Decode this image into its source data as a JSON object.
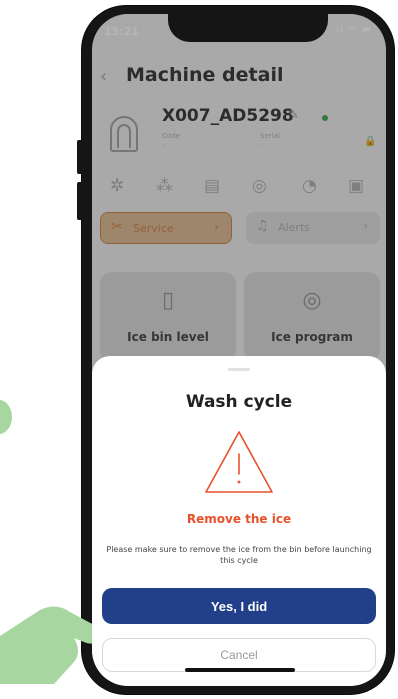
{
  "status": {
    "time": "15:21",
    "icons": "ıl ≈ ▬"
  },
  "header": {
    "back_glyph": "‹",
    "title": "Machine detail"
  },
  "machine": {
    "name": "X007_AD5298",
    "code_label": "Code",
    "serial_label": "Serial",
    "code_value": "-",
    "serial_value": "-",
    "status_color": "#2f9e44"
  },
  "icon_row": [
    "gear-fan-icon",
    "molecule-icon",
    "bin-icon",
    "program-icon",
    "chart-icon",
    "calendar-icon"
  ],
  "pills": {
    "service": {
      "label": "Service",
      "chevron": "›"
    },
    "alerts": {
      "label": "Alerts",
      "chevron": "›"
    }
  },
  "cards": [
    {
      "label": "Ice bin level"
    },
    {
      "label": "Ice program"
    }
  ],
  "sheet": {
    "title": "Wash cycle",
    "warning_title": "Remove the ice",
    "message": "Please make sure to remove the ice from the bin before launching this cycle",
    "confirm_label": "Yes, I did",
    "cancel_label": "Cancel"
  },
  "colors": {
    "accent": "#22408a",
    "warning": "#e8502a",
    "service": "#c87a3a",
    "hand": "#a8d6a0"
  }
}
